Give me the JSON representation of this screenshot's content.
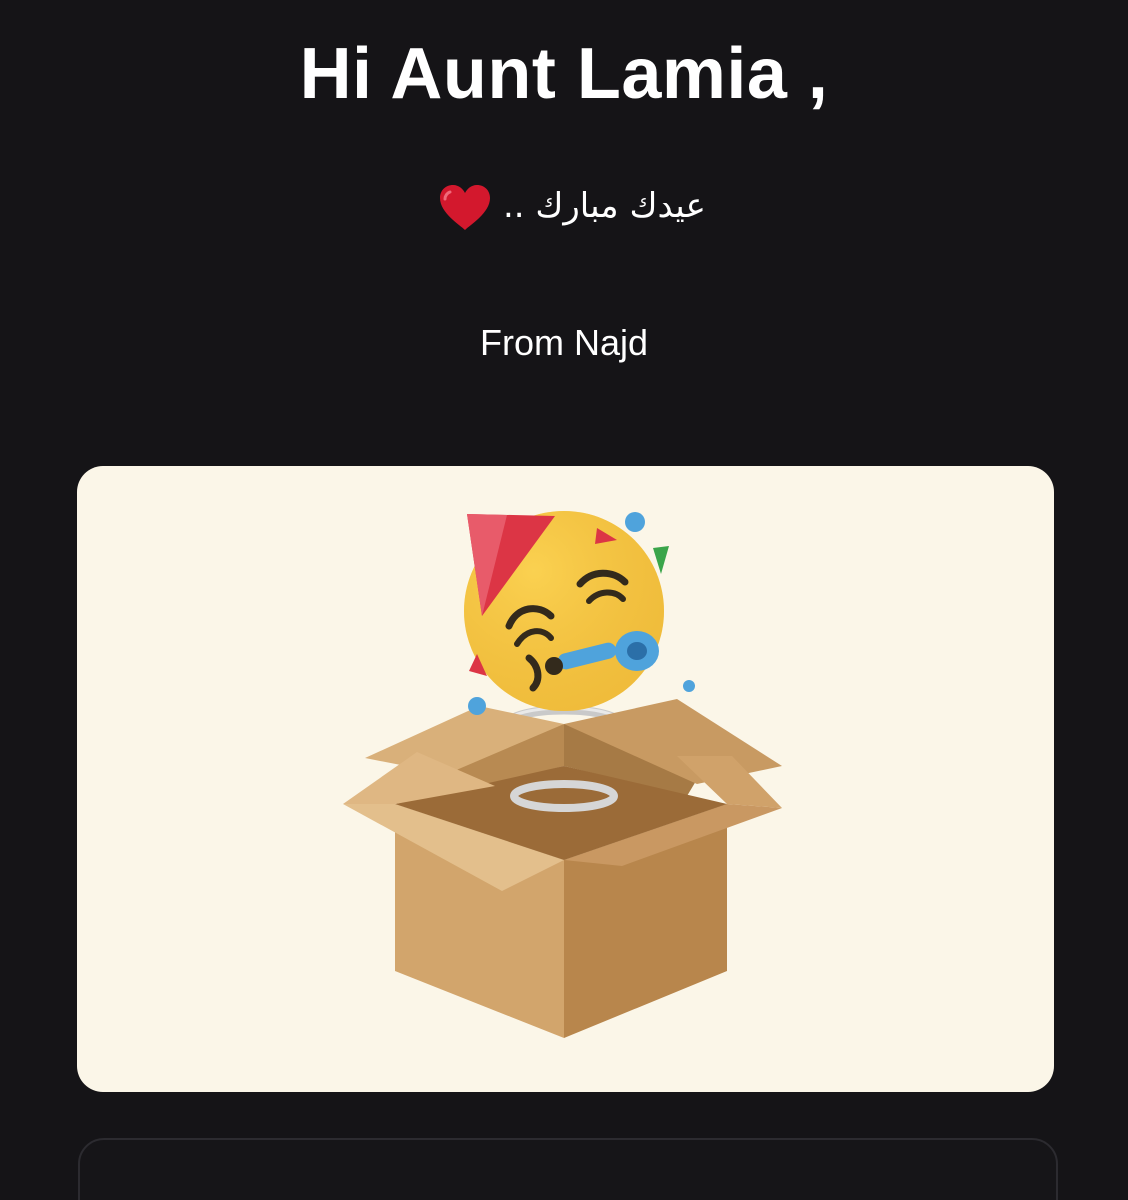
{
  "greeting": {
    "title": "Hi Aunt Lamia ,"
  },
  "message": {
    "text": "عيدك مبارك ..",
    "icon": "red-heart-icon"
  },
  "sender": {
    "text": "From Najd"
  },
  "gift_card": {
    "illustration": "jack-in-the-box-partying-face",
    "background_color": "#fbf6e8"
  },
  "colors": {
    "page_background": "#151417",
    "text": "#ffffff",
    "heart": "#d3182d"
  }
}
